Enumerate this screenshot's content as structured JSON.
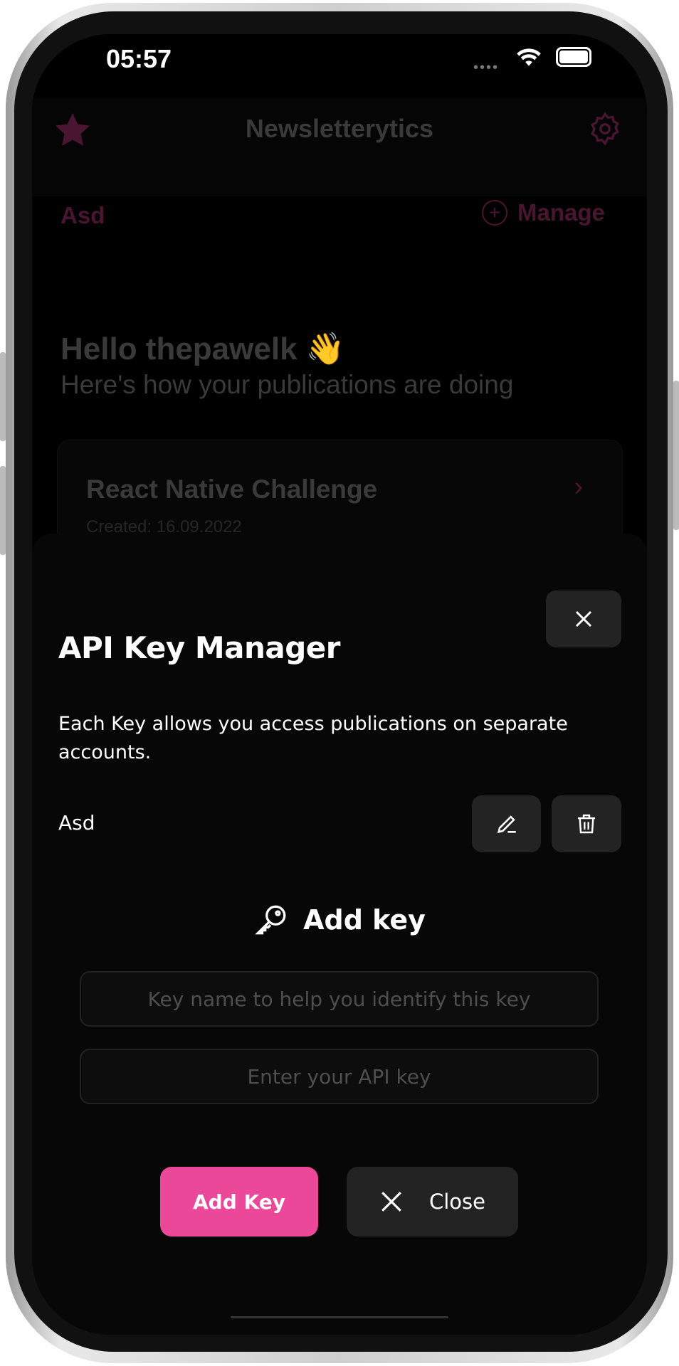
{
  "status_bar": {
    "time": "05:57"
  },
  "header": {
    "title": "Newsletterytics"
  },
  "account": {
    "selected": "Asd",
    "manage_label": "Manage"
  },
  "greeting": {
    "title": "Hello thepawelk 👋",
    "subtitle": "Here's how your publications are doing"
  },
  "publication": {
    "title": "React Native Challenge",
    "created": "Created: 16.09.2022"
  },
  "modal": {
    "title": "API Key Manager",
    "description": "Each Key allows you access publications on separate accounts.",
    "keys": [
      {
        "name": "Asd"
      }
    ],
    "add_section_title": "Add key",
    "key_name_placeholder": "Key name to help you identify this key",
    "api_key_placeholder": "Enter your API key",
    "add_button": "Add Key",
    "close_button": "Close"
  },
  "colors": {
    "accent": "#EC4899",
    "background": "#000000",
    "button": "#232323"
  }
}
